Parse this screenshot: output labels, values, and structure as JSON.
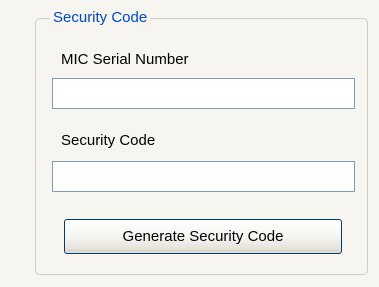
{
  "group": {
    "title": "Security Code"
  },
  "fields": {
    "serial": {
      "label": "MIC Serial Number",
      "value": ""
    },
    "code": {
      "label": "Security Code",
      "value": ""
    }
  },
  "actions": {
    "generate_label": "Generate Security Code"
  },
  "colors": {
    "panel_background": "#f6f5f0",
    "group_title": "#0046d5",
    "input_border": "#7f9db9",
    "button_border": "#003c74"
  }
}
